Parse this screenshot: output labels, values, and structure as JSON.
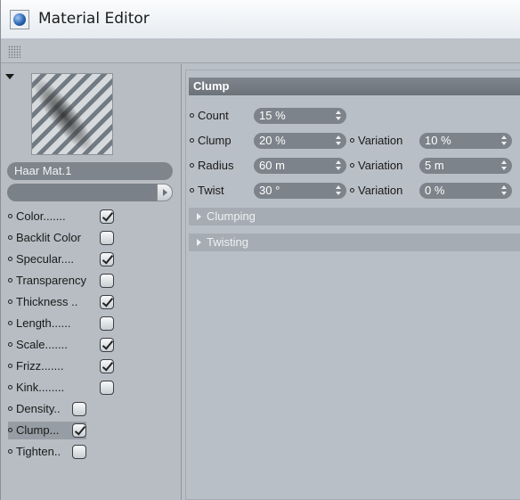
{
  "window": {
    "title": "Material Editor"
  },
  "material": {
    "name": "Haar Mat.1"
  },
  "channels": [
    {
      "label": "Color.......",
      "checked": true
    },
    {
      "label": "Backlit Color",
      "checked": false
    },
    {
      "label": "Specular....",
      "checked": true
    },
    {
      "label": "Transparency",
      "checked": false
    },
    {
      "label": "Thickness ..",
      "checked": true
    },
    {
      "label": "Length......",
      "checked": false
    },
    {
      "label": "Scale.......",
      "checked": true
    },
    {
      "label": "Frizz.......",
      "checked": true
    },
    {
      "label": "Kink........",
      "checked": false
    },
    {
      "label": "Density..",
      "checked": false
    },
    {
      "label": "Clump...",
      "checked": true,
      "selected": true
    },
    {
      "label": "Tighten..",
      "checked": false
    }
  ],
  "section": {
    "title": "Clump",
    "count": {
      "label": "Count",
      "value": "15 %"
    },
    "clump": {
      "label": "Clump",
      "value": "20 %",
      "variation_label": "Variation",
      "variation_value": "10 %"
    },
    "radius": {
      "label": "Radius",
      "value": "60 m",
      "variation_label": "Variation",
      "variation_value": "5 m"
    },
    "twist": {
      "label": "Twist",
      "value": "30 °",
      "variation_label": "Variation",
      "variation_value": "0 %"
    },
    "groups": [
      "Clumping",
      "Twisting"
    ]
  },
  "colors": {
    "panel": "#b9bfc6",
    "field": "#7c838a",
    "header": "#737a81"
  }
}
